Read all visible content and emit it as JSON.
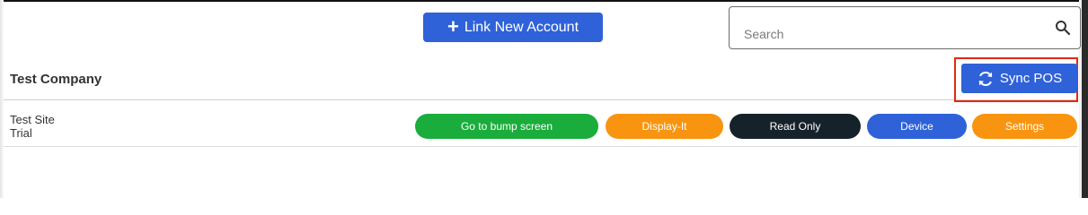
{
  "header": {
    "link_account_label": "Link New Account",
    "search": {
      "placeholder": "Search",
      "value": ""
    }
  },
  "company": {
    "name": "Test Company",
    "sync_label": "Sync POS"
  },
  "site": {
    "name": "Test Site",
    "status": "Trial",
    "actions": [
      {
        "label": "Go to bump screen",
        "color": "#1aad3c"
      },
      {
        "label": "Display-It",
        "color": "#f8940f"
      },
      {
        "label": "Read Only",
        "color": "#16222a"
      },
      {
        "label": "Device",
        "color": "#2f62d8"
      },
      {
        "label": "Settings",
        "color": "#f8940f"
      }
    ]
  },
  "colors": {
    "primary": "#2f62d8",
    "highlight": "#e02a12"
  },
  "icons": [
    "plus-icon",
    "search-icon",
    "sync-icon"
  ]
}
